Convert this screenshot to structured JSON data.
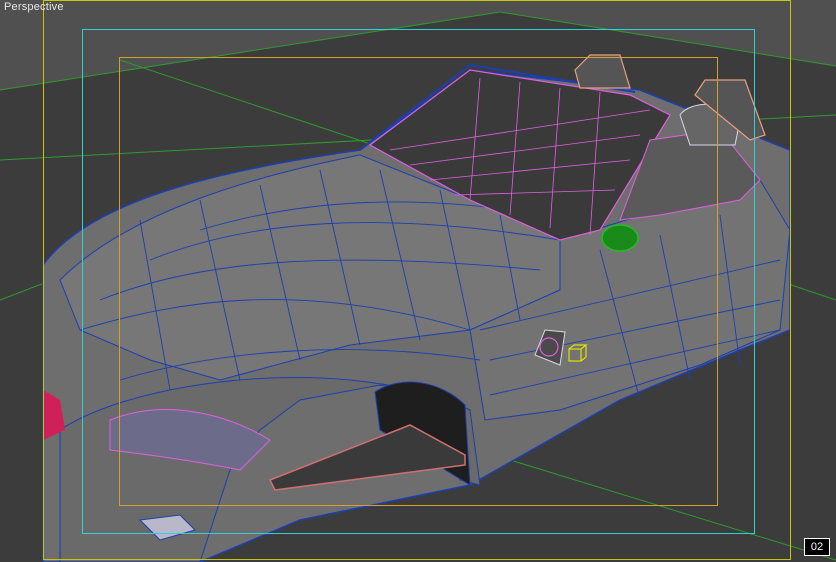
{
  "viewport": {
    "label": "Perspective",
    "frame_number": "02"
  },
  "colors": {
    "background": "#505050",
    "ground": "#3a3a3a",
    "grid_line": "#2f9a2f",
    "body_panel": "#707070",
    "wire_blue": "#1c3fb0",
    "wire_pink": "#e060e0",
    "selected_green": "#20c020",
    "helper_yellow": "#e0e000",
    "frame_yellow": "#c8c800",
    "frame_cyan": "#30d0d8",
    "frame_orange": "#d0a030"
  },
  "objects": {
    "car_body": "car-body-mesh",
    "windshield": "windshield-mesh",
    "seats": "seat-meshes",
    "mirror": "side-mirror-mesh",
    "side_marker": "side-marker-light-mesh",
    "helper": "dummy-helper-icon"
  }
}
